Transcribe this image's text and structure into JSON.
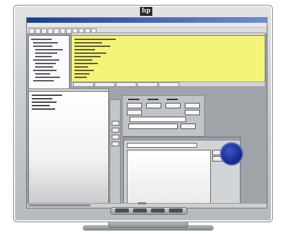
{
  "monitor": {
    "logo_text": "hp"
  },
  "app": {
    "title_text": "",
    "menu": [
      "",
      "",
      "",
      "",
      "",
      ""
    ],
    "accent_color": "#1b3d8f",
    "highlight_color": "#f5f47a",
    "round_button_color": "#16248a"
  },
  "icons": {
    "logo": "hp-logo-icon",
    "round_button": "blue-circle-button-icon"
  }
}
